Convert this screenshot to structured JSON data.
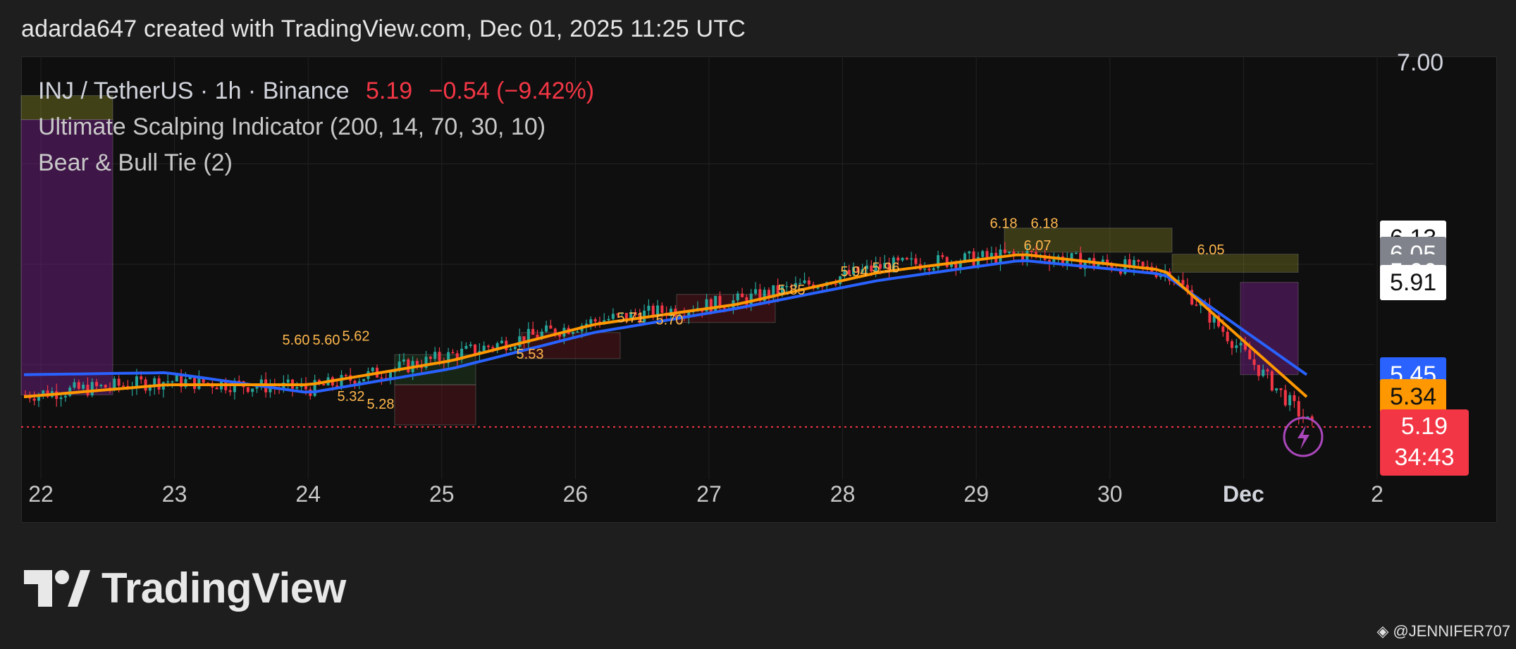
{
  "header": {
    "text": "adarda647 created with TradingView.com, Dec 01, 2025 11:25 UTC"
  },
  "legend": {
    "symbol": "INJ / TetherUS · 1h · Binance",
    "price": "5.19",
    "change": "−0.54 (−9.42%)",
    "indicator_1": "Ultimate Scalping Indicator (200, 14, 70, 30, 10)",
    "indicator_2": "Bear & Bull Tie (2)"
  },
  "price_axis": {
    "top_label": "7.00",
    "tags": [
      {
        "label": "6.13",
        "bg": "#ffffff",
        "fg": "#111111"
      },
      {
        "label": "6.05",
        "bg": "#80838c",
        "fg": "#ffffff"
      },
      {
        "label": "5.96",
        "bg": "#80838c",
        "fg": "#ffffff"
      },
      {
        "label": "5.91",
        "bg": "#ffffff",
        "fg": "#111111"
      },
      {
        "label": "5.45",
        "bg": "#2962ff",
        "fg": "#ffffff"
      },
      {
        "label": "5.34",
        "bg": "#ff9800",
        "fg": "#111111"
      }
    ],
    "last_price": {
      "label": "5.19",
      "countdown": "34:43",
      "bg": "#f23645",
      "fg": "#ffffff"
    }
  },
  "time_axis": [
    "22",
    "23",
    "24",
    "25",
    "26",
    "27",
    "28",
    "29",
    "30",
    "Dec",
    "2"
  ],
  "chart_data": {
    "type": "line",
    "title": "INJ / TetherUS · 1h · Binance",
    "x": [
      "22",
      "23",
      "24",
      "25",
      "26",
      "27",
      "28",
      "29",
      "30",
      "Dec",
      "2"
    ],
    "ylim": [
      5.0,
      7.0
    ],
    "grid": true,
    "series": [
      {
        "values": [
          5.35,
          5.42,
          5.38,
          5.55,
          5.72,
          5.82,
          5.99,
          6.05,
          5.96,
          5.19
        ]
      },
      {
        "values": [
          5.45,
          5.46,
          5.36,
          5.48,
          5.66,
          5.78,
          5.92,
          6.02,
          5.95,
          5.45
        ]
      },
      {
        "values": [
          5.34,
          5.4,
          5.4,
          5.52,
          5.7,
          5.8,
          5.96,
          6.05,
          5.97,
          5.34
        ]
      }
    ],
    "annotations": [
      "5.60",
      "5.60",
      "5.62",
      "5.32",
      "5.28",
      "5.53",
      "5.71",
      "5.70",
      "5.85",
      "5.94",
      "5.96",
      "6.18",
      "6.18",
      "6.05",
      "6.07"
    ],
    "colors": {
      "up": "#26a69a",
      "down": "#f23645",
      "ema_blue": "#2962ff",
      "ema_orange": "#ff9800"
    }
  },
  "logo": {
    "text": "TradingView"
  },
  "watermark": {
    "text": "@JENNIFER707"
  }
}
